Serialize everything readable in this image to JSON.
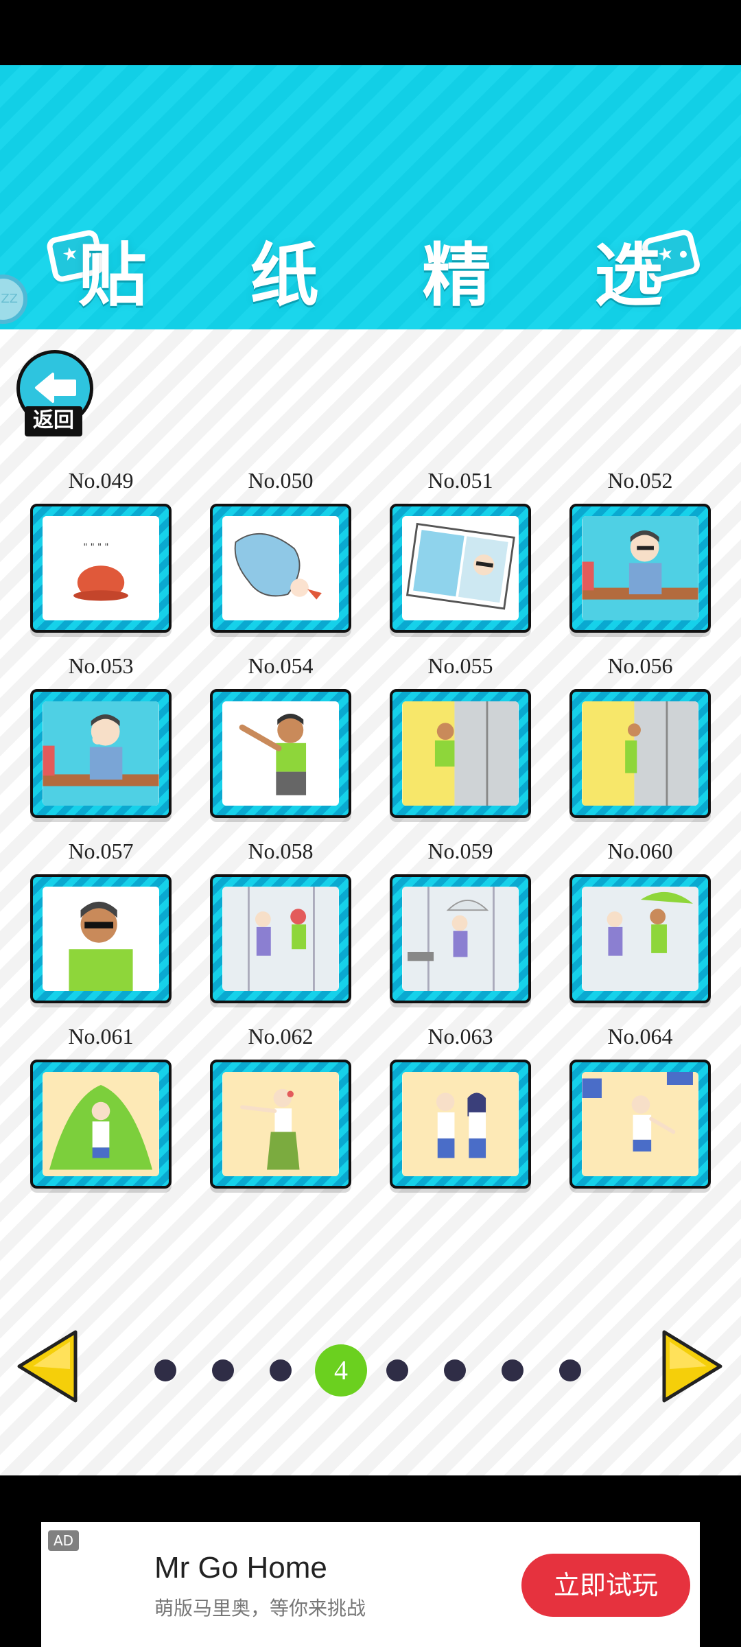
{
  "header": {
    "title": "贴 纸 精 选",
    "badge_text": "ZZ"
  },
  "back_button": {
    "label": "返回"
  },
  "stickers": [
    {
      "number": "No.049",
      "scene": "crab"
    },
    {
      "number": "No.050",
      "scene": "hermit-crab"
    },
    {
      "number": "No.051",
      "scene": "photo"
    },
    {
      "number": "No.052",
      "scene": "boy-sunglasses"
    },
    {
      "number": "No.053",
      "scene": "boy-facepalm"
    },
    {
      "number": "No.054",
      "scene": "boy-throw"
    },
    {
      "number": "No.055",
      "scene": "door-yellow"
    },
    {
      "number": "No.056",
      "scene": "door-peek"
    },
    {
      "number": "No.057",
      "scene": "boy-cool"
    },
    {
      "number": "No.058",
      "scene": "station-two"
    },
    {
      "number": "No.059",
      "scene": "station-umbrella"
    },
    {
      "number": "No.060",
      "scene": "station-pair"
    },
    {
      "number": "No.061",
      "scene": "leaves-costume"
    },
    {
      "number": "No.062",
      "scene": "hula"
    },
    {
      "number": "No.063",
      "scene": "couple"
    },
    {
      "number": "No.064",
      "scene": "relay"
    }
  ],
  "pager": {
    "total": 8,
    "current": 4,
    "current_label": "4"
  },
  "ad": {
    "tag": "AD",
    "title": "Mr Go Home",
    "subtitle": "萌版马里奥，等你来挑战",
    "cta": "立即试玩"
  },
  "colors": {
    "header": "#1bd6ec",
    "tile_border": "#16d1ea",
    "active_dot": "#6bd01f",
    "arrow": "#f5cf0a",
    "cta": "#e6323e"
  }
}
